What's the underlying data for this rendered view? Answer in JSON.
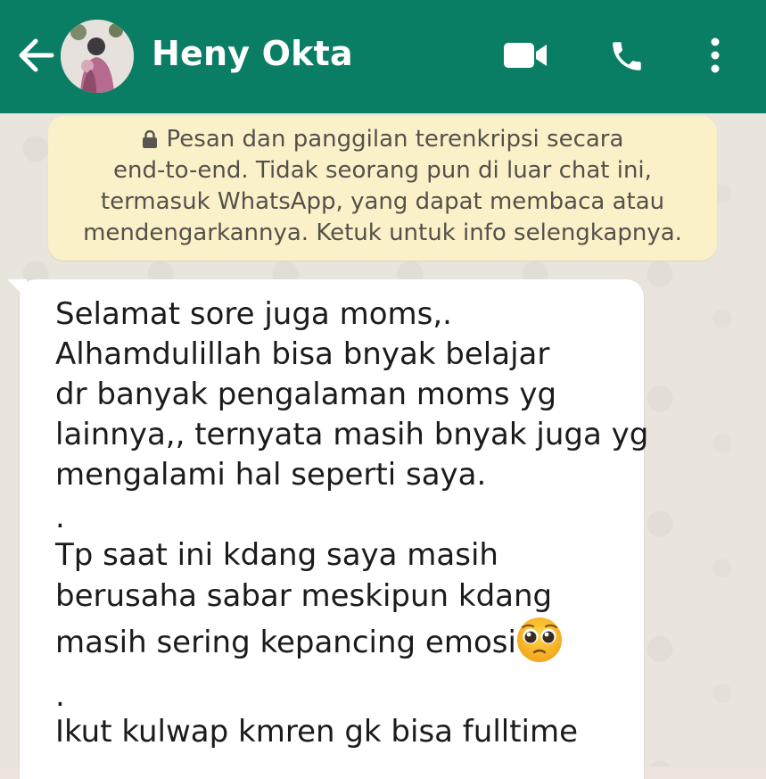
{
  "header": {
    "contact_name": "Heny Okta",
    "bg_color": "#0a7e64",
    "icons": [
      "arrow-left-icon",
      "video-camera-icon",
      "phone-icon",
      "more-vertical-icon"
    ]
  },
  "encryption_notice": {
    "lines": [
      "Pesan dan panggilan terenkripsi secara",
      "end-to-end. Tidak seorang pun di luar chat ini,",
      "termasuk WhatsApp, yang dapat membaca atau",
      "mendengarkannya. Ketuk untuk info selengkapnya."
    ],
    "icon": "lock-icon",
    "bg_color": "#fbf1c9"
  },
  "message": {
    "lines": [
      "Selamat sore juga moms,.",
      "Alhamdulillah bisa bnyak belajar",
      "dr banyak pengalaman moms yg",
      "lainnya,, ternyata masih bnyak juga yg",
      "mengalami hal seperti saya.",
      ".",
      "Tp saat ini kdang saya masih",
      "berusaha sabar meskipun kdang",
      "masih sering kepancing emosi",
      ".",
      "Ikut kulwap kmren gk bisa fulltime"
    ],
    "emoji": "pleading-face-emoji"
  }
}
